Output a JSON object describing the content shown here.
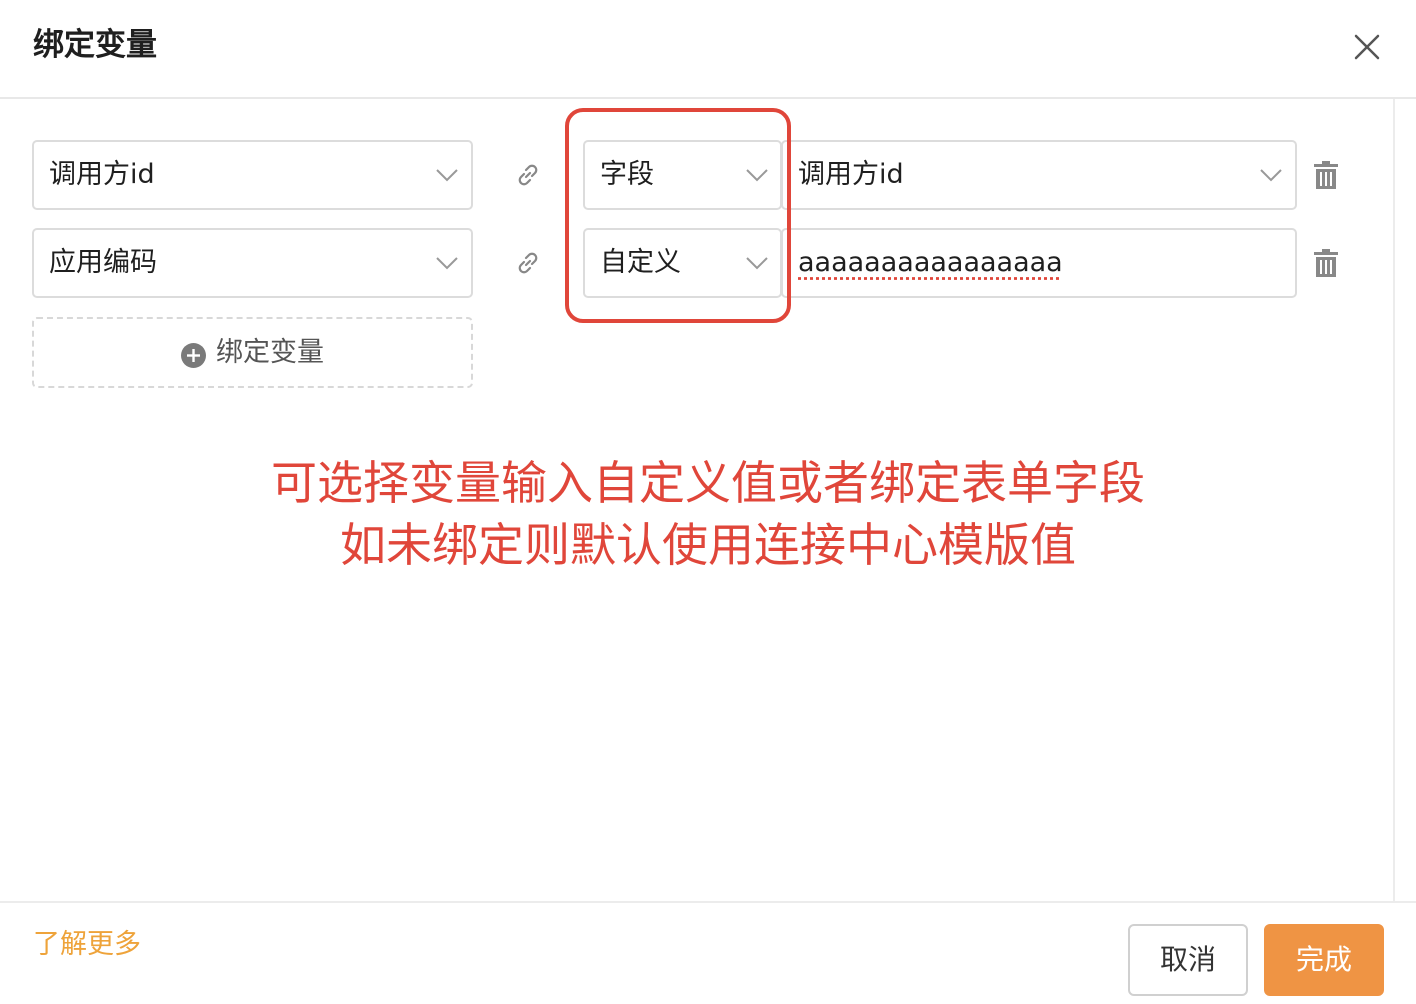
{
  "dialog": {
    "title": "绑定变量",
    "close_icon": "close-icon"
  },
  "bindings": [
    {
      "variable": "调用方id",
      "source_type": "字段",
      "value": "调用方id",
      "value_kind": "select"
    },
    {
      "variable": "应用编码",
      "source_type": "自定义",
      "value": "aaaaaaaaaaaaaaaa",
      "value_kind": "input"
    }
  ],
  "add_button": {
    "label": "绑定变量",
    "icon": "plus-circle-icon"
  },
  "annotation": {
    "line1": "可选择变量输入自定义值或者绑定表单字段",
    "line2": "如未绑定则默认使用连接中心模版值",
    "color": "#e0463a"
  },
  "footer": {
    "learn_more": "了解更多",
    "cancel": "取消",
    "confirm": "完成"
  },
  "colors": {
    "accent": "#ef9444",
    "link": "#eea33a",
    "highlight": "#e0463a"
  }
}
